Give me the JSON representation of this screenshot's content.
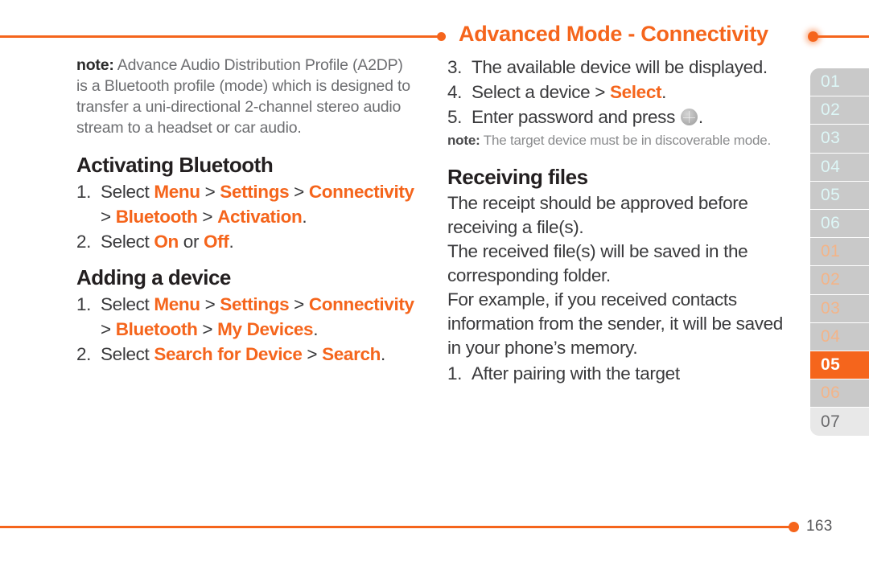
{
  "header": {
    "title": "Advanced Mode - Connectivity",
    "accent_color": "#f5651c"
  },
  "footer": {
    "page_number": "163"
  },
  "left_column": {
    "note": {
      "label": "note:",
      "text": " Advance Audio Distribution Profile (A2DP) is a Bluetooth profile (mode) which is designed to transfer a uni-directional 2-channel stereo audio stream to a headset or car audio."
    },
    "section_activating": {
      "heading": "Activating Bluetooth",
      "steps": [
        {
          "num": "1.",
          "parts": [
            {
              "t": "Select ",
              "s": "plain"
            },
            {
              "t": "Menu",
              "s": "hl"
            },
            {
              "t": " > ",
              "s": "gt"
            },
            {
              "t": "Settings",
              "s": "hl"
            },
            {
              "t": " > ",
              "s": "gt"
            },
            {
              "t": "Connectivity",
              "s": "hl"
            },
            {
              "t": " > ",
              "s": "gt"
            },
            {
              "t": "Bluetooth",
              "s": "hl"
            },
            {
              "t": " > ",
              "s": "gt"
            },
            {
              "t": "Activation",
              "s": "hl"
            },
            {
              "t": ".",
              "s": "plain"
            }
          ]
        },
        {
          "num": "2.",
          "parts": [
            {
              "t": "Select ",
              "s": "plain"
            },
            {
              "t": "On",
              "s": "hl"
            },
            {
              "t": " or ",
              "s": "plain"
            },
            {
              "t": "Off",
              "s": "hl"
            },
            {
              "t": ".",
              "s": "plain"
            }
          ]
        }
      ]
    },
    "section_adding": {
      "heading": "Adding a device",
      "steps": [
        {
          "num": "1.",
          "parts": [
            {
              "t": "Select ",
              "s": "plain"
            },
            {
              "t": "Menu",
              "s": "hl"
            },
            {
              "t": " > ",
              "s": "gt"
            },
            {
              "t": "Settings",
              "s": "hl"
            },
            {
              "t": " > ",
              "s": "gt"
            },
            {
              "t": "Connectivity",
              "s": "hl"
            },
            {
              "t": " > ",
              "s": "gt"
            },
            {
              "t": "Bluetooth",
              "s": "hl"
            },
            {
              "t": " > ",
              "s": "gt"
            },
            {
              "t": "My Devices",
              "s": "hl"
            },
            {
              "t": ".",
              "s": "plain"
            }
          ]
        },
        {
          "num": "2.",
          "parts": [
            {
              "t": "Select ",
              "s": "plain"
            },
            {
              "t": "Search for Device",
              "s": "hl"
            },
            {
              "t": " > ",
              "s": "gt"
            },
            {
              "t": "Search",
              "s": "hl"
            },
            {
              "t": ".",
              "s": "plain"
            }
          ]
        }
      ]
    }
  },
  "right_column": {
    "steps_continued": [
      {
        "num": "3.",
        "parts": [
          {
            "t": "The available device will be displayed.",
            "s": "plain"
          }
        ]
      },
      {
        "num": "4.",
        "parts": [
          {
            "t": "Select a device ",
            "s": "plain"
          },
          {
            "t": "> ",
            "s": "gt"
          },
          {
            "t": "Select",
            "s": "hl"
          },
          {
            "t": ".",
            "s": "plain"
          }
        ]
      },
      {
        "num": "5.",
        "parts": [
          {
            "t": "Enter password and press ",
            "s": "plain"
          },
          {
            "t": "",
            "s": "key-icon"
          },
          {
            "t": ".",
            "s": "plain"
          }
        ]
      }
    ],
    "note": {
      "label": "note:",
      "text": " The target device must be in discoverable mode."
    },
    "section_receiving": {
      "heading": "Receiving files",
      "paragraphs": [
        "The receipt should be approved before receiving a file(s).",
        "The received file(s) will be saved in the corresponding folder.",
        "For example, if you received contacts information from the sender, it will be saved in your phone’s memory."
      ],
      "steps": [
        {
          "num": "1.",
          "parts": [
            {
              "t": "After pairing with the target",
              "s": "plain"
            }
          ]
        }
      ]
    }
  },
  "tab_rail": {
    "groups": [
      {
        "style": "g1",
        "tabs": [
          {
            "label": "01"
          },
          {
            "label": "02"
          },
          {
            "label": "03"
          },
          {
            "label": "04"
          },
          {
            "label": "05"
          },
          {
            "label": "06"
          }
        ]
      },
      {
        "style": "g2",
        "tabs": [
          {
            "label": "01"
          },
          {
            "label": "02"
          },
          {
            "label": "03"
          },
          {
            "label": "04"
          },
          {
            "label": "05",
            "active": true
          },
          {
            "label": "06"
          },
          {
            "label": "07",
            "last": true
          }
        ]
      }
    ]
  }
}
